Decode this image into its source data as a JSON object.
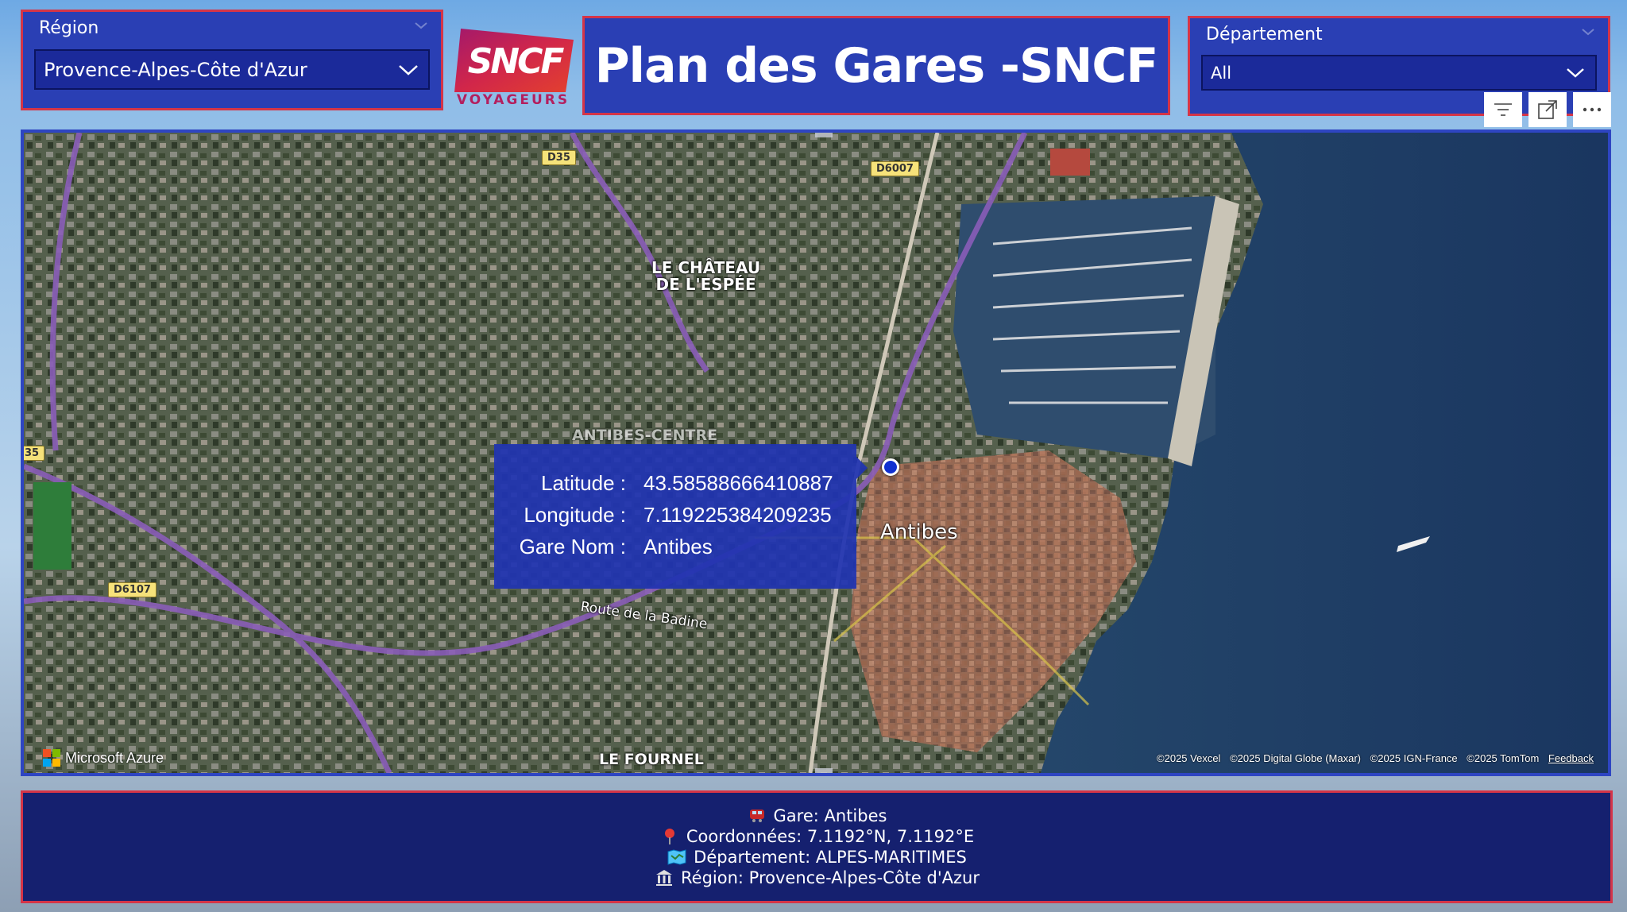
{
  "region_slicer": {
    "title": "Région",
    "selected": "Provence-Alpes-Côte d'Azur"
  },
  "logo": {
    "mark": "SNCF",
    "subtitle": "VOYAGEURS"
  },
  "page_title": "Plan des Gares -SNCF",
  "departement_slicer": {
    "title": "Département",
    "selected": "All"
  },
  "visual_header": {
    "icons": [
      "filter-icon",
      "focus-mode-icon",
      "more-options-icon"
    ]
  },
  "map": {
    "labels": {
      "chateau": "LE CHÂTEAU\nDE L'ESPÉE",
      "antibes_centre": "ANTIBES-CENTRE",
      "antibes": "Antibes",
      "route": "Route de la Badine",
      "fournel": "LE FOURNEL"
    },
    "roads": [
      "D35",
      "D6007",
      "D6107",
      "35"
    ],
    "tooltip": {
      "rows": [
        {
          "key": "Latitude :",
          "value": "43.58588666410887"
        },
        {
          "key": "Longitude :",
          "value": "7.119225384209235"
        },
        {
          "key": "Gare Nom :",
          "value": "Antibes"
        }
      ]
    },
    "provider": "Microsoft Azure",
    "attribution": [
      "©2025 Vexcel",
      "©2025 Digital Globe (Maxar)",
      "©2025 IGN-France",
      "©2025 TomTom"
    ],
    "feedback": "Feedback"
  },
  "info_card": {
    "gare": "Gare: Antibes",
    "coordonnees": "Coordonnées: 7.1192°N, 7.1192°E",
    "departement": "Département: ALPES-MARITIMES",
    "region": "Région: Provence-Alpes-Côte d'Azur"
  },
  "colors": {
    "panel_blue": "#2a3fb4",
    "border_red": "#d43548",
    "card_navy": "#15206f",
    "sncf_magenta": "#b41f5e"
  }
}
